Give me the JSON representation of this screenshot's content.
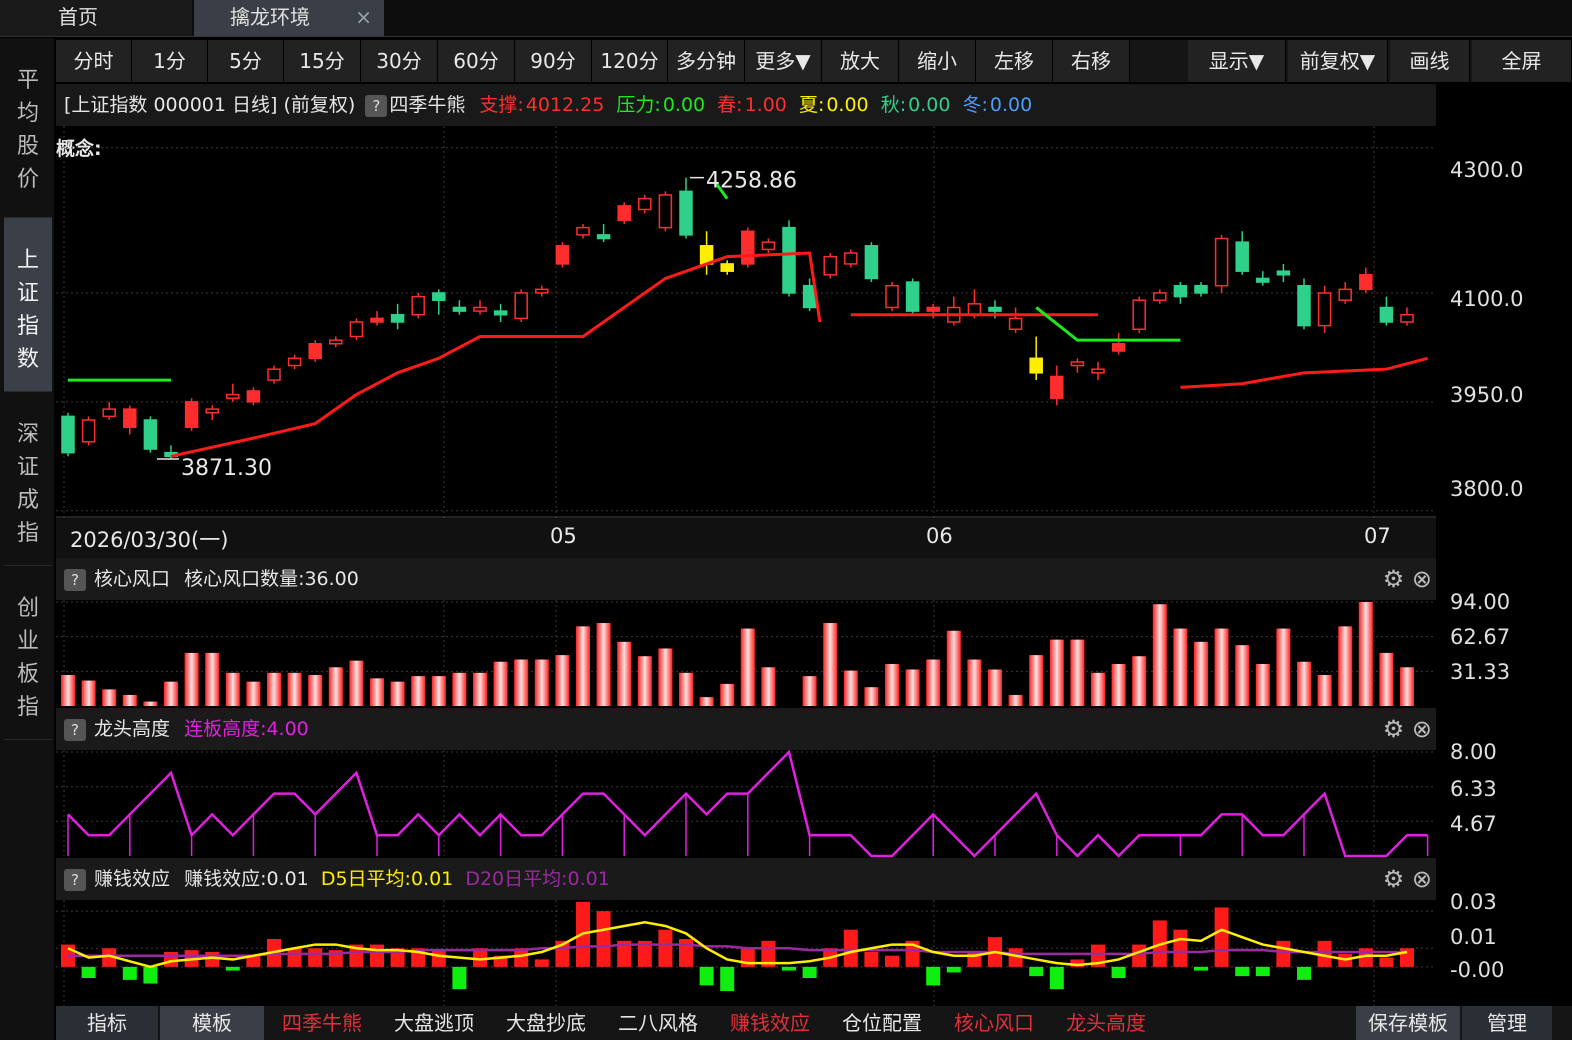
{
  "tabs": {
    "home": "首页",
    "env": "擒龙环境",
    "close": "×"
  },
  "sidebar": [
    {
      "label": "平均股价",
      "active": false
    },
    {
      "label": "上证指数",
      "active": true
    },
    {
      "label": "深证成指",
      "active": false
    },
    {
      "label": "创业板指",
      "active": false
    }
  ],
  "toolbar": [
    "分时",
    "1分",
    "5分",
    "15分",
    "30分",
    "60分",
    "90分",
    "120分",
    "多分钟",
    "更多▼",
    "放大",
    "缩小",
    "左移",
    "右移",
    "显示▼",
    "前复权▼",
    "画线",
    "全屏"
  ],
  "info": {
    "title": "[上证指数 000001 日线]  (前复权)",
    "help": "?",
    "indicator": "四季牛熊",
    "support_label": "支撑:",
    "support": "4012.25",
    "pressure_label": "压力:",
    "pressure": "0.00",
    "spring_label": "春:",
    "spring": "1.00",
    "summer_label": "夏:",
    "summer": "0.00",
    "autumn_label": "秋:",
    "autumn": "0.00",
    "winter_label": "冬:",
    "winter": "0.00"
  },
  "concept": "概念:",
  "main_chart": {
    "y_ticks": [
      "4300.0",
      "4100.0",
      "3950.0",
      "3800.0"
    ],
    "high_label": "4258.86",
    "low_label": "3871.30",
    "date_start": "2026/03/30(一)",
    "month_labels": [
      "05",
      "06",
      "07"
    ]
  },
  "panel1": {
    "help": "?",
    "name": "核心风口",
    "value_label": "核心风口数量:36.00",
    "y_ticks": [
      "94.00",
      "62.67",
      "31.33"
    ]
  },
  "panel2": {
    "help": "?",
    "name": "龙头高度",
    "value_label": "连板高度:4.00",
    "y_ticks": [
      "8.00",
      "6.33",
      "4.67"
    ]
  },
  "panel3": {
    "help": "?",
    "name": "赚钱效应",
    "value_label": "赚钱效应:0.01",
    "d5_label": "D5日平均:0.01",
    "d20_label": "D20日平均:0.01",
    "y_ticks": [
      "0.03",
      "0.01",
      "-0.00"
    ]
  },
  "bottom": {
    "left": [
      "指标",
      "模板"
    ],
    "items": [
      "四季牛熊",
      "大盘逃顶",
      "大盘抄底",
      "二八风格",
      "赚钱效应",
      "仓位配置",
      "核心风口",
      "龙头高度"
    ],
    "right": [
      "保存模板",
      "管理"
    ]
  },
  "colors": {
    "up": "#ff2d2d",
    "down": "#2fd08a",
    "support": "#ff1a1a",
    "pressure": "#1ee81e",
    "yellow": "#ffee00",
    "magenta": "#e020e0",
    "purple": "#9a2aa0"
  },
  "chart_data": [
    {
      "type": "candlestick",
      "title": "上证指数 000001 日线",
      "ylim": [
        3790,
        4330
      ],
      "y_ticks": [
        4300,
        4100,
        3950,
        3800
      ],
      "candles": [
        [
          3930,
          3880,
          3935,
          3875
        ],
        [
          3895,
          3925,
          3930,
          3890
        ],
        [
          3930,
          3940,
          3950,
          3925
        ],
        [
          3915,
          3940,
          3945,
          3905
        ],
        [
          3925,
          3885,
          3930,
          3880
        ],
        [
          3880,
          3875,
          3890,
          3871
        ],
        [
          3915,
          3950,
          3955,
          3910
        ],
        [
          3935,
          3940,
          3945,
          3925
        ],
        [
          3955,
          3960,
          3975,
          3950
        ],
        [
          3950,
          3965,
          3970,
          3945
        ],
        [
          3980,
          3995,
          4000,
          3975
        ],
        [
          4000,
          4010,
          4015,
          3995
        ],
        [
          4010,
          4030,
          4035,
          4005
        ],
        [
          4030,
          4035,
          4040,
          4025
        ],
        [
          4040,
          4060,
          4065,
          4035
        ],
        [
          4060,
          4065,
          4075,
          4055
        ],
        [
          4070,
          4060,
          4085,
          4050
        ],
        [
          4070,
          4095,
          4100,
          4065
        ],
        [
          4100,
          4090,
          4105,
          4070
        ],
        [
          4080,
          4075,
          4090,
          4070
        ],
        [
          4075,
          4080,
          4090,
          4070
        ],
        [
          4075,
          4070,
          4085,
          4060
        ],
        [
          4065,
          4100,
          4105,
          4060
        ],
        [
          4100,
          4105,
          4110,
          4095
        ],
        [
          4140,
          4165,
          4170,
          4135
        ],
        [
          4180,
          4190,
          4195,
          4175
        ],
        [
          4180,
          4175,
          4195,
          4170
        ],
        [
          4200,
          4220,
          4225,
          4195
        ],
        [
          4215,
          4230,
          4235,
          4210
        ],
        [
          4190,
          4235,
          4240,
          4185
        ],
        [
          4240,
          4180,
          4258.86,
          4175
        ],
        [
          4165,
          4140,
          4185,
          4125
        ],
        [
          4140,
          4130,
          4145,
          4125
        ],
        [
          4140,
          4185,
          4190,
          4135
        ],
        [
          4160,
          4170,
          4175,
          4155
        ],
        [
          4190,
          4100,
          4200,
          4095
        ],
        [
          4110,
          4080,
          4120,
          4075
        ],
        [
          4125,
          4150,
          4155,
          4120
        ],
        [
          4140,
          4155,
          4160,
          4135
        ],
        [
          4165,
          4120,
          4170,
          4115
        ],
        [
          4080,
          4110,
          4115,
          4075
        ],
        [
          4115,
          4075,
          4120,
          4070
        ],
        [
          4075,
          4080,
          4085,
          4065
        ],
        [
          4060,
          4080,
          4095,
          4055
        ],
        [
          4070,
          4085,
          4105,
          4065
        ],
        [
          4080,
          4075,
          4090,
          4065
        ],
        [
          4050,
          4065,
          4080,
          4045
        ],
        [
          4010,
          3990,
          4040,
          3980
        ],
        [
          3955,
          3985,
          4000,
          3945
        ],
        [
          4000,
          4005,
          4010,
          3990
        ],
        [
          3990,
          3995,
          4005,
          3980
        ],
        [
          4020,
          4030,
          4045,
          4015
        ],
        [
          4050,
          4090,
          4095,
          4045
        ],
        [
          4090,
          4100,
          4105,
          4085
        ],
        [
          4110,
          4095,
          4115,
          4085
        ],
        [
          4110,
          4100,
          4115,
          4095
        ],
        [
          4110,
          4175,
          4180,
          4100
        ],
        [
          4170,
          4130,
          4185,
          4125
        ],
        [
          4120,
          4115,
          4130,
          4110
        ],
        [
          4130,
          4125,
          4140,
          4115
        ],
        [
          4110,
          4055,
          4120,
          4050
        ],
        [
          4055,
          4100,
          4110,
          4045
        ],
        [
          4090,
          4105,
          4115,
          4085
        ],
        [
          4105,
          4125,
          4135,
          4100
        ],
        [
          4080,
          4060,
          4095,
          4055
        ],
        [
          4060,
          4070,
          4080,
          4055
        ]
      ],
      "support_line": [
        [
          5,
          3875
        ],
        [
          9,
          3900
        ],
        [
          12,
          3920
        ],
        [
          14,
          3960
        ],
        [
          16,
          3990
        ],
        [
          18,
          4010
        ],
        [
          20,
          4040
        ],
        [
          25,
          4040
        ],
        [
          27,
          4080
        ],
        [
          29,
          4120
        ],
        [
          32,
          4150
        ],
        [
          36,
          4155
        ],
        [
          36.5,
          4060
        ],
        [
          38,
          4070
        ],
        [
          45,
          4070
        ],
        [
          50,
          4070
        ],
        [
          54,
          3970
        ],
        [
          57,
          3975
        ],
        [
          60,
          3990
        ],
        [
          64,
          3995
        ],
        [
          66,
          4010
        ]
      ],
      "pressure_line": [
        [
          0,
          3980
        ],
        [
          5,
          3980
        ]
      ],
      "pressure_line2": [
        [
          47,
          4080
        ],
        [
          49,
          4035
        ],
        [
          54,
          4035
        ]
      ]
    },
    {
      "type": "bar",
      "title": "核心风口",
      "ylim": [
        0,
        94
      ],
      "values": [
        28,
        23,
        15,
        10,
        4,
        22,
        48,
        48,
        30,
        22,
        30,
        30,
        28,
        35,
        41,
        25,
        22,
        27,
        27,
        30,
        30,
        40,
        42,
        42,
        46,
        72,
        75,
        58,
        45,
        52,
        30,
        8,
        20,
        70,
        35,
        0,
        27,
        75,
        32,
        17,
        38,
        33,
        42,
        68,
        42,
        33,
        10,
        46,
        60,
        60,
        30,
        38,
        45,
        92,
        70,
        58,
        70,
        55,
        38,
        70,
        40,
        28,
        72,
        94,
        48,
        35
      ]
    },
    {
      "type": "line",
      "title": "龙头高度",
      "ylim": [
        3,
        8
      ],
      "values": [
        5,
        4,
        4,
        5,
        6,
        7,
        4,
        5,
        4,
        5,
        6,
        6,
        5,
        6,
        7,
        4,
        4,
        5,
        4,
        5,
        4,
        5,
        4,
        4,
        5,
        6,
        6,
        5,
        4,
        5,
        6,
        5,
        6,
        6,
        7,
        8,
        4,
        4,
        4,
        3,
        3,
        4,
        5,
        4,
        3,
        4,
        5,
        6,
        4,
        3,
        4,
        3,
        4,
        4,
        4,
        4,
        5,
        5,
        4,
        4,
        5,
        6,
        3,
        3,
        3,
        4,
        4
      ]
    },
    {
      "type": "bar",
      "title": "赚钱效应",
      "ylim": [
        -0.02,
        0.036
      ],
      "values": [
        0.012,
        -0.006,
        0.01,
        -0.007,
        -0.009,
        0.008,
        0.009,
        0.008,
        -0.002,
        0.006,
        0.015,
        0.01,
        0.01,
        0.009,
        0.012,
        0.012,
        0.01,
        0.01,
        0.009,
        -0.012,
        0.01,
        0.006,
        0.01,
        0.004,
        0.014,
        0.035,
        0.03,
        0.014,
        0.014,
        0.02,
        0.015,
        -0.01,
        -0.013,
        0.01,
        0.014,
        -0.002,
        -0.006,
        0.01,
        0.02,
        0.008,
        0.006,
        0.014,
        -0.01,
        -0.003,
        0.008,
        0.016,
        0.01,
        -0.005,
        -0.012,
        0.004,
        0.012,
        -0.006,
        0.012,
        0.025,
        0.02,
        -0.002,
        0.032,
        -0.005,
        -0.005,
        0.014,
        -0.007,
        0.014,
        0.007,
        0.01,
        0.005,
        0.01
      ],
      "d5": [
        0.01,
        0.005,
        0.006,
        0.003,
        0.0,
        0.003,
        0.004,
        0.005,
        0.004,
        0.006,
        0.008,
        0.01,
        0.012,
        0.012,
        0.01,
        0.009,
        0.009,
        0.008,
        0.006,
        0.005,
        0.004,
        0.005,
        0.006,
        0.008,
        0.012,
        0.018,
        0.02,
        0.022,
        0.024,
        0.022,
        0.018,
        0.01,
        0.004,
        0.002,
        0.002,
        0.002,
        0.003,
        0.005,
        0.008,
        0.01,
        0.012,
        0.012,
        0.008,
        0.006,
        0.006,
        0.008,
        0.006,
        0.004,
        0.002,
        0.001,
        0.002,
        0.004,
        0.008,
        0.012,
        0.015,
        0.014,
        0.02,
        0.016,
        0.012,
        0.01,
        0.008,
        0.006,
        0.004,
        0.006,
        0.006,
        0.008
      ],
      "d20": [
        0.006,
        0.006,
        0.006,
        0.006,
        0.006,
        0.006,
        0.006,
        0.006,
        0.006,
        0.006,
        0.007,
        0.007,
        0.007,
        0.007,
        0.008,
        0.008,
        0.008,
        0.009,
        0.009,
        0.009,
        0.009,
        0.009,
        0.009,
        0.01,
        0.01,
        0.011,
        0.011,
        0.012,
        0.012,
        0.012,
        0.012,
        0.011,
        0.011,
        0.01,
        0.01,
        0.01,
        0.009,
        0.009,
        0.009,
        0.009,
        0.009,
        0.009,
        0.008,
        0.008,
        0.008,
        0.008,
        0.007,
        0.007,
        0.007,
        0.007,
        0.007,
        0.007,
        0.007,
        0.008,
        0.008,
        0.008,
        0.009,
        0.009,
        0.009,
        0.008,
        0.008,
        0.008,
        0.008,
        0.008,
        0.008,
        0.008
      ]
    }
  ]
}
